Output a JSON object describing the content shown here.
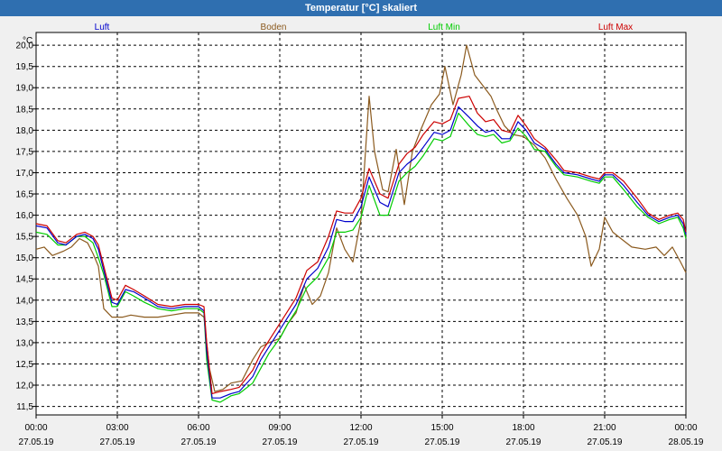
{
  "window": {
    "title": "Temperatur [°C] skaliert"
  },
  "chart_data": {
    "type": "line",
    "ylabel": "°C",
    "ylim": [
      11.3,
      20.3
    ],
    "xlim": [
      0,
      24
    ],
    "grid": true,
    "legend_placement": "top",
    "y_ticks": [
      "20,0",
      "19,5",
      "19,0",
      "18,5",
      "18,0",
      "17,5",
      "17,0",
      "16,5",
      "16,0",
      "15,5",
      "15,0",
      "14,5",
      "14,0",
      "13,5",
      "13,0",
      "12,5",
      "12,0",
      "11,5"
    ],
    "y_tick_values": [
      20.0,
      19.5,
      19.0,
      18.5,
      18.0,
      17.5,
      17.0,
      16.5,
      16.0,
      15.5,
      15.0,
      14.5,
      14.0,
      13.5,
      13.0,
      12.5,
      12.0,
      11.5
    ],
    "x_ticks": [
      {
        "time": "00:00",
        "date": "27.05.19"
      },
      {
        "time": "03:00",
        "date": "27.05.19"
      },
      {
        "time": "06:00",
        "date": "27.05.19"
      },
      {
        "time": "09:00",
        "date": "27.05.19"
      },
      {
        "time": "12:00",
        "date": "27.05.19"
      },
      {
        "time": "15:00",
        "date": "27.05.19"
      },
      {
        "time": "18:00",
        "date": "27.05.19"
      },
      {
        "time": "21:00",
        "date": "27.05.19"
      },
      {
        "time": "00:00",
        "date": "28.05.19"
      }
    ],
    "x_tick_values": [
      0,
      3,
      6,
      9,
      12,
      15,
      18,
      21,
      24
    ],
    "series": [
      {
        "name": "Luft",
        "color": "#0000cc",
        "points": [
          [
            0,
            15.75
          ],
          [
            0.4,
            15.7
          ],
          [
            0.8,
            15.35
          ],
          [
            1.1,
            15.3
          ],
          [
            1.5,
            15.5
          ],
          [
            1.8,
            15.55
          ],
          [
            2.1,
            15.45
          ],
          [
            2.3,
            15.2
          ],
          [
            2.5,
            14.7
          ],
          [
            2.8,
            13.95
          ],
          [
            3.0,
            13.9
          ],
          [
            3.3,
            14.25
          ],
          [
            3.6,
            14.2
          ],
          [
            4.0,
            14.05
          ],
          [
            4.5,
            13.85
          ],
          [
            5.0,
            13.8
          ],
          [
            5.5,
            13.85
          ],
          [
            6.0,
            13.85
          ],
          [
            6.2,
            13.75
          ],
          [
            6.3,
            12.8
          ],
          [
            6.5,
            11.7
          ],
          [
            6.8,
            11.7
          ],
          [
            7.2,
            11.8
          ],
          [
            7.5,
            11.85
          ],
          [
            8.0,
            12.2
          ],
          [
            8.3,
            12.6
          ],
          [
            8.6,
            12.9
          ],
          [
            9.0,
            13.3
          ],
          [
            9.3,
            13.6
          ],
          [
            9.6,
            13.9
          ],
          [
            10.0,
            14.5
          ],
          [
            10.4,
            14.75
          ],
          [
            10.8,
            15.25
          ],
          [
            11.1,
            15.9
          ],
          [
            11.4,
            15.85
          ],
          [
            11.7,
            15.85
          ],
          [
            12.0,
            16.2
          ],
          [
            12.3,
            16.9
          ],
          [
            12.7,
            16.3
          ],
          [
            13.0,
            16.2
          ],
          [
            13.4,
            17.0
          ],
          [
            13.7,
            17.2
          ],
          [
            14.0,
            17.35
          ],
          [
            14.3,
            17.6
          ],
          [
            14.7,
            17.95
          ],
          [
            15.0,
            17.9
          ],
          [
            15.3,
            18.0
          ],
          [
            15.6,
            18.55
          ],
          [
            16.0,
            18.3
          ],
          [
            16.3,
            18.1
          ],
          [
            16.6,
            17.95
          ],
          [
            16.9,
            18.0
          ],
          [
            17.2,
            17.8
          ],
          [
            17.5,
            17.8
          ],
          [
            17.8,
            18.2
          ],
          [
            18.1,
            18.0
          ],
          [
            18.4,
            17.7
          ],
          [
            18.8,
            17.55
          ],
          [
            19.2,
            17.2
          ],
          [
            19.5,
            17.0
          ],
          [
            20.0,
            16.95
          ],
          [
            20.5,
            16.85
          ],
          [
            20.8,
            16.8
          ],
          [
            21.0,
            16.95
          ],
          [
            21.3,
            16.95
          ],
          [
            21.7,
            16.7
          ],
          [
            22.2,
            16.3
          ],
          [
            22.6,
            16.0
          ],
          [
            23.0,
            15.85
          ],
          [
            23.4,
            15.95
          ],
          [
            23.7,
            16.0
          ],
          [
            23.9,
            15.8
          ],
          [
            24.0,
            15.55
          ]
        ]
      },
      {
        "name": "Boden",
        "color": "#8b5a1e",
        "points": [
          [
            0,
            15.2
          ],
          [
            0.3,
            15.25
          ],
          [
            0.6,
            15.05
          ],
          [
            1.0,
            15.15
          ],
          [
            1.3,
            15.25
          ],
          [
            1.6,
            15.45
          ],
          [
            1.9,
            15.35
          ],
          [
            2.1,
            15.1
          ],
          [
            2.3,
            14.8
          ],
          [
            2.5,
            13.8
          ],
          [
            2.8,
            13.6
          ],
          [
            3.2,
            13.6
          ],
          [
            3.5,
            13.65
          ],
          [
            4.0,
            13.6
          ],
          [
            4.5,
            13.6
          ],
          [
            5.0,
            13.65
          ],
          [
            5.5,
            13.7
          ],
          [
            6.0,
            13.7
          ],
          [
            6.2,
            13.6
          ],
          [
            6.4,
            12.4
          ],
          [
            6.6,
            11.85
          ],
          [
            6.9,
            11.9
          ],
          [
            7.2,
            12.05
          ],
          [
            7.6,
            12.1
          ],
          [
            8.0,
            12.6
          ],
          [
            8.3,
            12.9
          ],
          [
            8.6,
            13.0
          ],
          [
            9.0,
            13.1
          ],
          [
            9.3,
            13.45
          ],
          [
            9.6,
            13.7
          ],
          [
            9.9,
            14.35
          ],
          [
            10.2,
            13.9
          ],
          [
            10.5,
            14.1
          ],
          [
            10.8,
            14.65
          ],
          [
            11.1,
            15.7
          ],
          [
            11.4,
            15.2
          ],
          [
            11.7,
            14.9
          ],
          [
            12.0,
            15.9
          ],
          [
            12.3,
            18.8
          ],
          [
            12.5,
            17.5
          ],
          [
            12.8,
            16.6
          ],
          [
            13.0,
            16.55
          ],
          [
            13.3,
            17.55
          ],
          [
            13.6,
            16.25
          ],
          [
            13.9,
            17.5
          ],
          [
            14.2,
            18.0
          ],
          [
            14.6,
            18.6
          ],
          [
            14.9,
            18.85
          ],
          [
            15.1,
            19.5
          ],
          [
            15.4,
            18.6
          ],
          [
            15.7,
            19.3
          ],
          [
            15.9,
            20.0
          ],
          [
            16.2,
            19.3
          ],
          [
            16.5,
            19.05
          ],
          [
            16.8,
            18.8
          ],
          [
            17.0,
            18.5
          ],
          [
            17.3,
            18.1
          ],
          [
            17.6,
            17.9
          ],
          [
            18.0,
            17.85
          ],
          [
            18.4,
            17.65
          ],
          [
            18.8,
            17.35
          ],
          [
            19.2,
            16.85
          ],
          [
            19.6,
            16.4
          ],
          [
            20.0,
            16.0
          ],
          [
            20.3,
            15.5
          ],
          [
            20.5,
            14.8
          ],
          [
            20.8,
            15.2
          ],
          [
            21.0,
            15.95
          ],
          [
            21.3,
            15.6
          ],
          [
            21.6,
            15.45
          ],
          [
            22.0,
            15.25
          ],
          [
            22.5,
            15.2
          ],
          [
            22.9,
            15.25
          ],
          [
            23.2,
            15.05
          ],
          [
            23.5,
            15.25
          ],
          [
            23.8,
            14.9
          ],
          [
            24.0,
            14.65
          ]
        ]
      },
      {
        "name": "Luft Min",
        "color": "#00cc00",
        "points": [
          [
            0,
            15.6
          ],
          [
            0.4,
            15.55
          ],
          [
            0.8,
            15.3
          ],
          [
            1.1,
            15.3
          ],
          [
            1.5,
            15.5
          ],
          [
            1.8,
            15.5
          ],
          [
            2.1,
            15.35
          ],
          [
            2.3,
            15.0
          ],
          [
            2.5,
            14.6
          ],
          [
            2.8,
            13.85
          ],
          [
            3.0,
            13.85
          ],
          [
            3.3,
            14.2
          ],
          [
            3.6,
            14.1
          ],
          [
            4.0,
            13.95
          ],
          [
            4.5,
            13.8
          ],
          [
            5.0,
            13.75
          ],
          [
            5.5,
            13.8
          ],
          [
            6.0,
            13.8
          ],
          [
            6.2,
            13.7
          ],
          [
            6.3,
            12.6
          ],
          [
            6.5,
            11.65
          ],
          [
            6.8,
            11.6
          ],
          [
            7.2,
            11.75
          ],
          [
            7.5,
            11.8
          ],
          [
            8.0,
            12.05
          ],
          [
            8.3,
            12.4
          ],
          [
            8.6,
            12.75
          ],
          [
            9.0,
            13.1
          ],
          [
            9.3,
            13.45
          ],
          [
            9.6,
            13.75
          ],
          [
            10.0,
            14.3
          ],
          [
            10.4,
            14.55
          ],
          [
            10.8,
            15.0
          ],
          [
            11.1,
            15.6
          ],
          [
            11.4,
            15.6
          ],
          [
            11.7,
            15.65
          ],
          [
            12.0,
            15.95
          ],
          [
            12.3,
            16.7
          ],
          [
            12.7,
            16.0
          ],
          [
            13.0,
            16.0
          ],
          [
            13.4,
            16.8
          ],
          [
            13.7,
            17.0
          ],
          [
            14.0,
            17.15
          ],
          [
            14.3,
            17.4
          ],
          [
            14.7,
            17.8
          ],
          [
            15.0,
            17.75
          ],
          [
            15.3,
            17.85
          ],
          [
            15.6,
            18.4
          ],
          [
            16.0,
            18.1
          ],
          [
            16.3,
            17.9
          ],
          [
            16.6,
            17.85
          ],
          [
            16.9,
            17.9
          ],
          [
            17.2,
            17.7
          ],
          [
            17.5,
            17.75
          ],
          [
            17.8,
            18.05
          ],
          [
            18.1,
            17.85
          ],
          [
            18.4,
            17.55
          ],
          [
            18.8,
            17.5
          ],
          [
            19.2,
            17.15
          ],
          [
            19.5,
            16.95
          ],
          [
            20.0,
            16.9
          ],
          [
            20.5,
            16.8
          ],
          [
            20.8,
            16.75
          ],
          [
            21.0,
            16.9
          ],
          [
            21.3,
            16.9
          ],
          [
            21.7,
            16.6
          ],
          [
            22.2,
            16.2
          ],
          [
            22.6,
            15.95
          ],
          [
            23.0,
            15.8
          ],
          [
            23.4,
            15.9
          ],
          [
            23.7,
            15.95
          ],
          [
            23.9,
            15.7
          ],
          [
            24.0,
            15.45
          ]
        ]
      },
      {
        "name": "Luft Max",
        "color": "#cc0000",
        "points": [
          [
            0,
            15.8
          ],
          [
            0.4,
            15.75
          ],
          [
            0.8,
            15.4
          ],
          [
            1.1,
            15.35
          ],
          [
            1.5,
            15.55
          ],
          [
            1.8,
            15.6
          ],
          [
            2.1,
            15.5
          ],
          [
            2.3,
            15.3
          ],
          [
            2.5,
            14.8
          ],
          [
            2.8,
            14.05
          ],
          [
            3.0,
            14.0
          ],
          [
            3.3,
            14.35
          ],
          [
            3.6,
            14.25
          ],
          [
            4.0,
            14.1
          ],
          [
            4.5,
            13.9
          ],
          [
            5.0,
            13.85
          ],
          [
            5.5,
            13.9
          ],
          [
            6.0,
            13.9
          ],
          [
            6.2,
            13.85
          ],
          [
            6.3,
            13.0
          ],
          [
            6.5,
            11.8
          ],
          [
            6.8,
            11.85
          ],
          [
            7.2,
            11.9
          ],
          [
            7.5,
            11.95
          ],
          [
            8.0,
            12.35
          ],
          [
            8.3,
            12.75
          ],
          [
            8.6,
            13.05
          ],
          [
            9.0,
            13.45
          ],
          [
            9.3,
            13.75
          ],
          [
            9.6,
            14.05
          ],
          [
            10.0,
            14.7
          ],
          [
            10.4,
            14.9
          ],
          [
            10.8,
            15.5
          ],
          [
            11.1,
            16.1
          ],
          [
            11.4,
            16.05
          ],
          [
            11.7,
            16.05
          ],
          [
            12.0,
            16.4
          ],
          [
            12.3,
            17.1
          ],
          [
            12.7,
            16.5
          ],
          [
            13.0,
            16.4
          ],
          [
            13.4,
            17.2
          ],
          [
            13.7,
            17.45
          ],
          [
            14.0,
            17.6
          ],
          [
            14.3,
            17.9
          ],
          [
            14.7,
            18.2
          ],
          [
            15.0,
            18.15
          ],
          [
            15.3,
            18.25
          ],
          [
            15.6,
            18.75
          ],
          [
            16.0,
            18.8
          ],
          [
            16.3,
            18.4
          ],
          [
            16.6,
            18.2
          ],
          [
            16.9,
            18.25
          ],
          [
            17.2,
            18.0
          ],
          [
            17.5,
            17.95
          ],
          [
            17.8,
            18.35
          ],
          [
            18.1,
            18.1
          ],
          [
            18.4,
            17.8
          ],
          [
            18.8,
            17.6
          ],
          [
            19.2,
            17.3
          ],
          [
            19.5,
            17.05
          ],
          [
            20.0,
            17.0
          ],
          [
            20.5,
            16.9
          ],
          [
            20.8,
            16.85
          ],
          [
            21.0,
            17.0
          ],
          [
            21.3,
            17.0
          ],
          [
            21.7,
            16.8
          ],
          [
            22.2,
            16.4
          ],
          [
            22.6,
            16.05
          ],
          [
            23.0,
            15.9
          ],
          [
            23.4,
            16.0
          ],
          [
            23.7,
            16.05
          ],
          [
            23.9,
            15.9
          ],
          [
            24.0,
            15.6
          ]
        ]
      }
    ]
  }
}
